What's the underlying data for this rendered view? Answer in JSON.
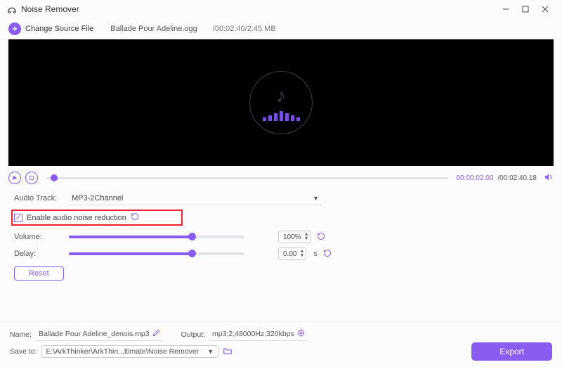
{
  "title": "Noise Remover",
  "source": {
    "change_label": "Change Source File",
    "filename": "Ballade Pour Adeline.ogg",
    "meta": "/00:02:40/2.45 MB"
  },
  "play": {
    "current": "00:00:02.00",
    "total": "/00:02:40.18"
  },
  "track": {
    "label": "Audio Track:",
    "value": "MP3-2Channel"
  },
  "enable": {
    "label": "Enable audio noise reduction"
  },
  "volume": {
    "label": "Volume:",
    "value": "100%",
    "fill": 70
  },
  "delay": {
    "label": "Delay:",
    "value": "0.00",
    "unit": "s",
    "fill": 70
  },
  "reset": "Reset",
  "output": {
    "name_label": "Name:",
    "name": "Ballade Pour Adeline_denois.mp3",
    "out_label": "Output:",
    "out_value": "mp3;2;48000Hz;320kbps",
    "save_label": "Save to:",
    "save_path": "E:\\ArkThinker\\ArkThin...ltimate\\Noise Remover",
    "export": "Export"
  }
}
